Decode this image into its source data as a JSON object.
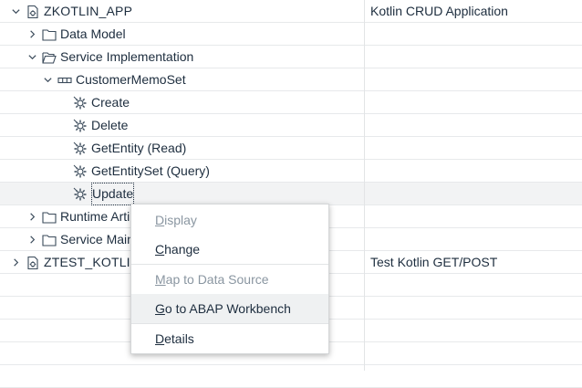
{
  "tree": {
    "rows": [
      {
        "label": "ZKOTLIN_APP",
        "description": "Kotlin CRUD Application",
        "icon": "service-project-icon",
        "expander": "expanded"
      },
      {
        "label": "Data Model",
        "description": "",
        "icon": "folder-icon",
        "expander": "collapsed"
      },
      {
        "label": "Service Implementation",
        "description": "",
        "icon": "folder-open-icon",
        "expander": "expanded"
      },
      {
        "label": "CustomerMemoSet",
        "description": "",
        "icon": "entity-set-icon",
        "expander": "expanded"
      },
      {
        "label": "Create",
        "description": "",
        "icon": "gear-operation-icon",
        "expander": "none"
      },
      {
        "label": "Delete",
        "description": "",
        "icon": "gear-operation-icon",
        "expander": "none"
      },
      {
        "label": "GetEntity (Read)",
        "description": "",
        "icon": "gear-operation-icon",
        "expander": "none"
      },
      {
        "label": "GetEntitySet (Query)",
        "description": "",
        "icon": "gear-operation-icon",
        "expander": "none"
      },
      {
        "label": "Update",
        "description": "",
        "icon": "gear-operation-icon",
        "expander": "none"
      },
      {
        "label": "Runtime Arti",
        "description": "",
        "icon": "folder-icon",
        "expander": "collapsed"
      },
      {
        "label": "Service Main",
        "description": "",
        "icon": "folder-icon",
        "expander": "collapsed"
      },
      {
        "label": "ZTEST_KOTLIN",
        "description": "Test Kotlin GET/POST",
        "icon": "service-project-icon",
        "expander": "collapsed"
      }
    ]
  },
  "context_menu": {
    "items": [
      {
        "pre": "",
        "u": "D",
        "post": "isplay",
        "enabled": false
      },
      {
        "pre": "",
        "u": "C",
        "post": "hange",
        "enabled": true
      },
      {
        "pre": "",
        "u": "M",
        "post": "ap to Data Source",
        "enabled": false
      },
      {
        "pre": "",
        "u": "G",
        "post": "o to ABAP Workbench",
        "enabled": true
      },
      {
        "pre": "",
        "u": "D",
        "post": "etails",
        "enabled": true
      }
    ]
  },
  "colors": {
    "text": "#1d2d3e",
    "disabled_text": "#8a96a1",
    "icon": "#3a4a5a",
    "selected_row": "#f2f3f4",
    "menu_hover": "#eff1f2"
  }
}
